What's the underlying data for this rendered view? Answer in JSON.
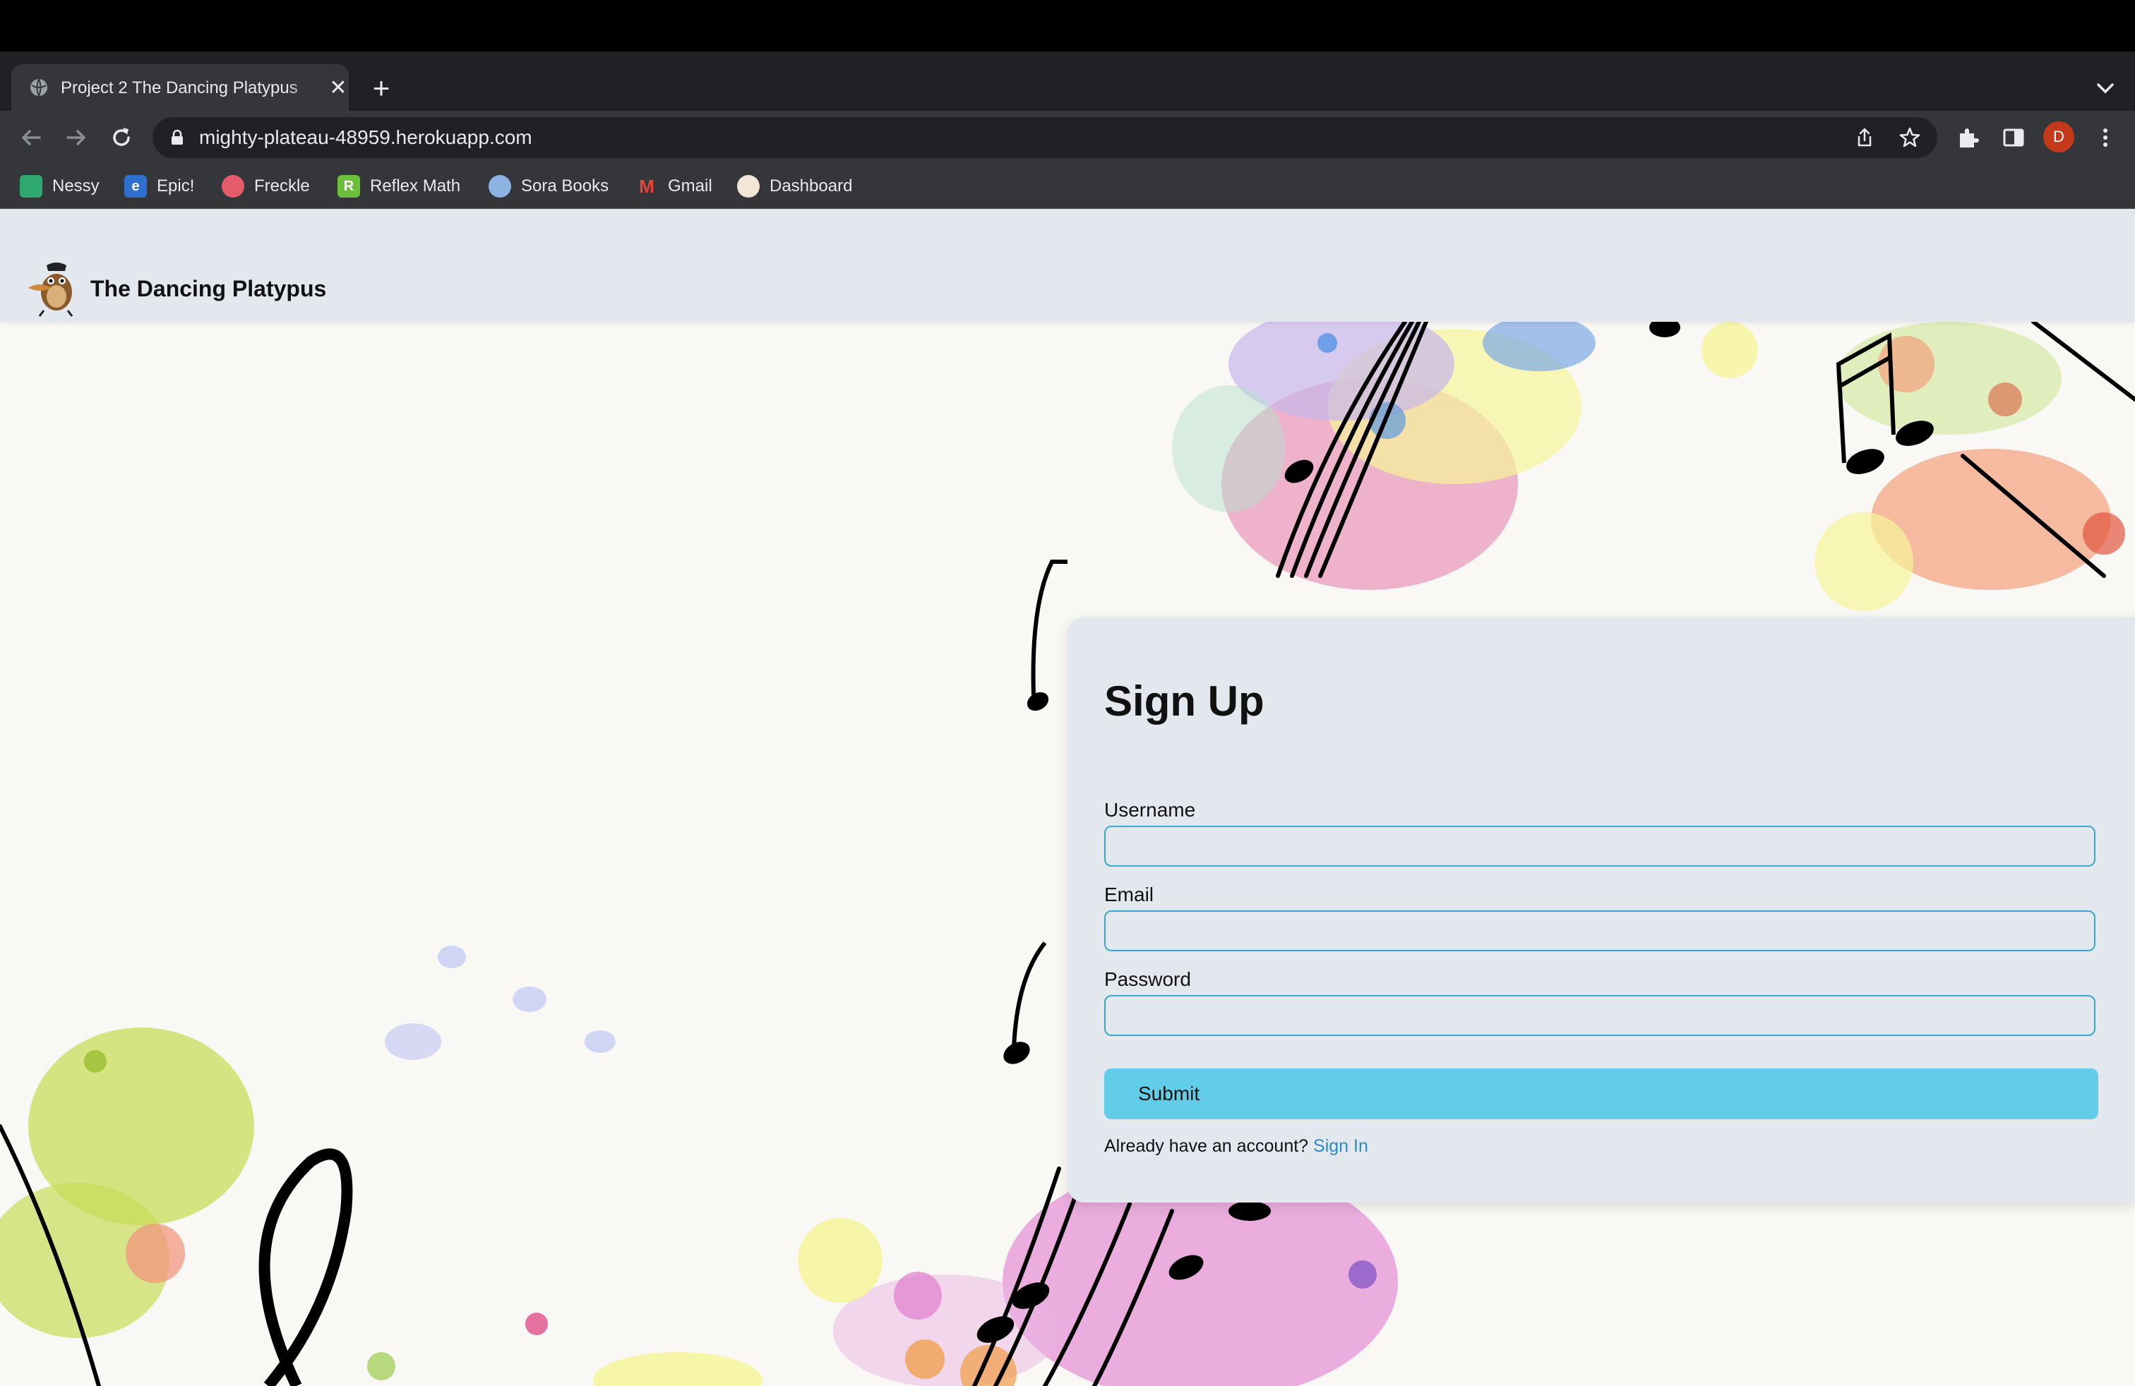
{
  "browser": {
    "tab": {
      "title": "Project 2 The Dancing Platypus"
    },
    "url": "mighty-plateau-48959.herokuapp.com",
    "profile_initial": "D",
    "bookmarks": [
      {
        "label": "Nessy",
        "icon": "nessy-icon"
      },
      {
        "label": "Epic!",
        "icon": "epic-icon"
      },
      {
        "label": "Freckle",
        "icon": "freckle-icon"
      },
      {
        "label": "Reflex Math",
        "icon": "reflex-math-icon"
      },
      {
        "label": "Sora Books",
        "icon": "sora-books-icon"
      },
      {
        "label": "Gmail",
        "icon": "gmail-icon"
      },
      {
        "label": "Dashboard",
        "icon": "dashboard-icon"
      }
    ]
  },
  "site": {
    "brand": "The Dancing Platypus",
    "logo_icon": "platypus-logo-icon"
  },
  "signup": {
    "title": "Sign Up",
    "username_label": "Username",
    "username_value": "",
    "email_label": "Email",
    "email_value": "",
    "password_label": "Password",
    "password_value": "",
    "submit_label": "Submit",
    "account_prompt": "Already have an account?",
    "signin_link": "Sign In"
  },
  "colors": {
    "header_bg": "#e3e7ee",
    "input_border": "#3aa8c9",
    "submit_bg": "#62cde8",
    "link": "#2a8dbf"
  }
}
